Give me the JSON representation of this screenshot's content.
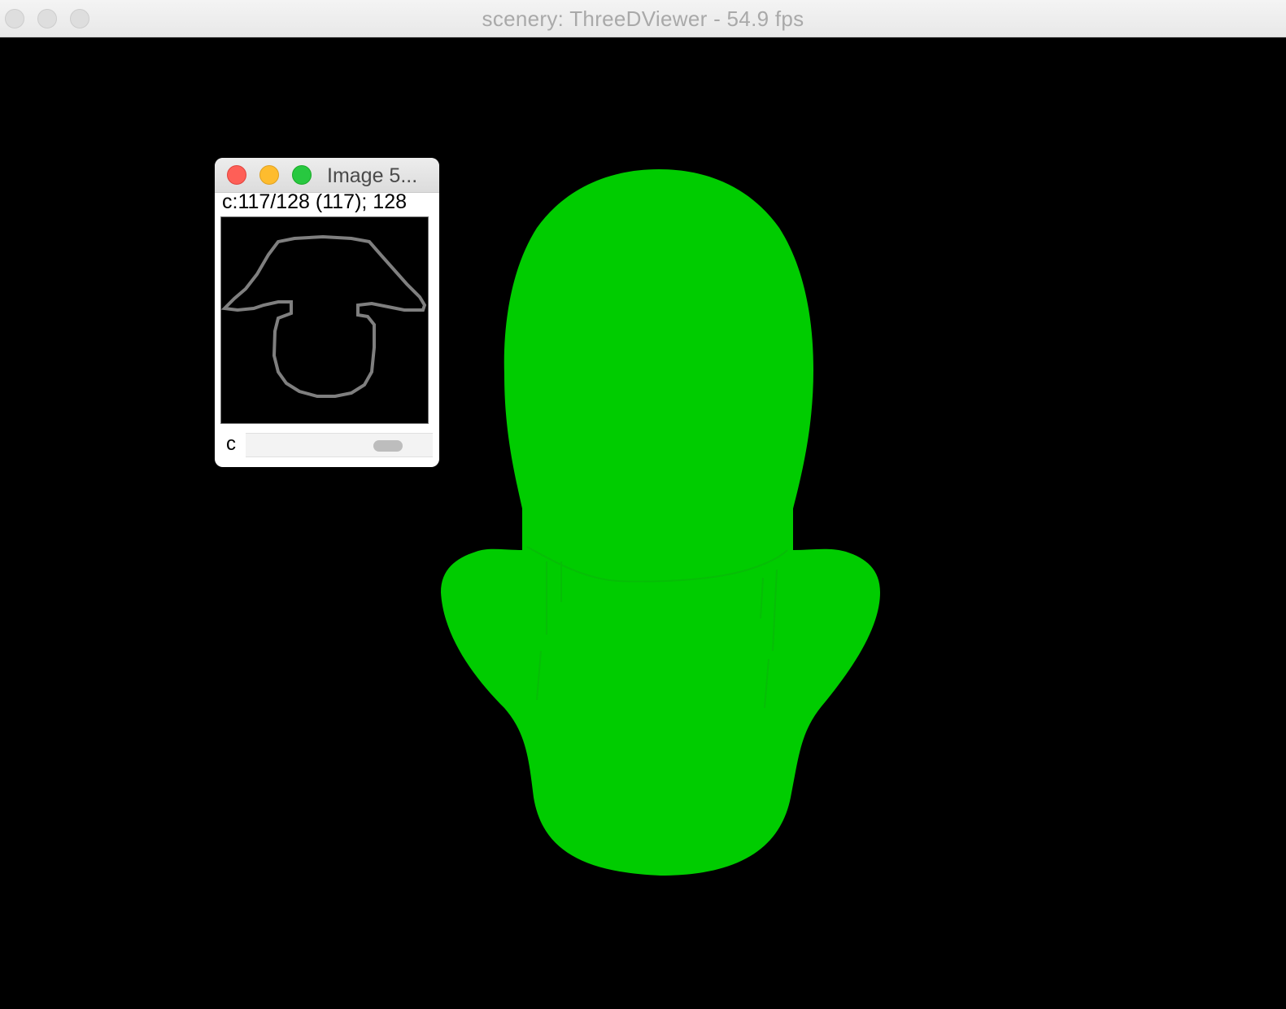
{
  "window": {
    "title": "scenery: ThreeDViewer - 54.9 fps"
  },
  "viewport": {
    "background": "#000000",
    "mesh_color": "#00cc00"
  },
  "image_window": {
    "title": "Image 5...",
    "status": "c:117/128 (117); 128",
    "slider": {
      "label": "c",
      "value": 117,
      "max": 128
    }
  }
}
